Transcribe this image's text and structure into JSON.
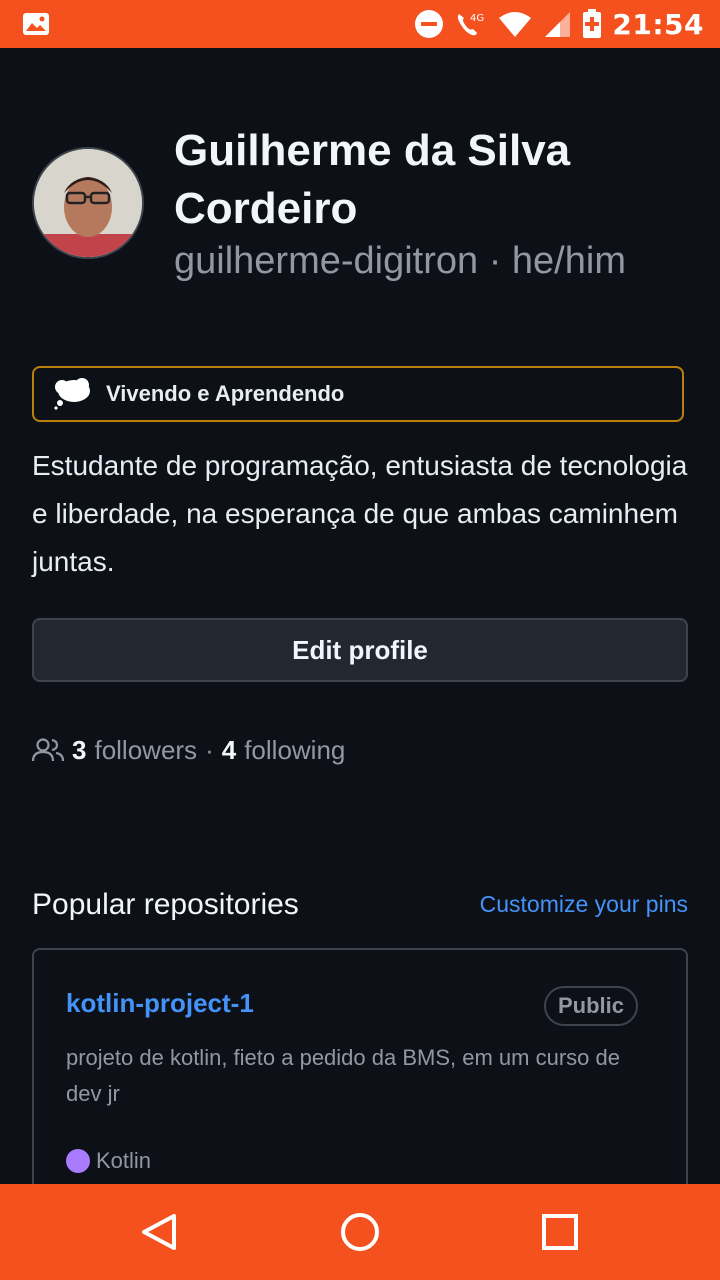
{
  "status_bar": {
    "time": "21:54",
    "network": "4G",
    "icons": [
      "image-icon",
      "dnd-icon",
      "volte-call-icon",
      "wifi-icon",
      "signal-icon",
      "battery-icon"
    ]
  },
  "profile": {
    "name": "Guilherme da Silva Cordeiro",
    "username_pronouns": "guilherme-digitron · he/him",
    "status": "Vivendo e Aprendendo",
    "bio": "Estudante de programação, entusiasta de tecnologia e liberdade, na esperança de que ambas caminhem juntas.",
    "edit_button": "Edit profile",
    "followers_count": "3",
    "followers_label": "followers",
    "following_count": "4",
    "following_label": "following"
  },
  "popular": {
    "title": "Popular repositories",
    "customize_link": "Customize your pins",
    "repos": [
      {
        "name": "kotlin-project-1",
        "visibility": "Public",
        "description": "projeto de kotlin, fieto a pedido da BMS, em um curso de dev jr",
        "language": "Kotlin",
        "language_color": "#a97bff"
      }
    ]
  },
  "colors": {
    "background": "#0d1117",
    "system_bars": "#f4511e",
    "link": "#4493f8",
    "status_border": "#bb8009"
  }
}
